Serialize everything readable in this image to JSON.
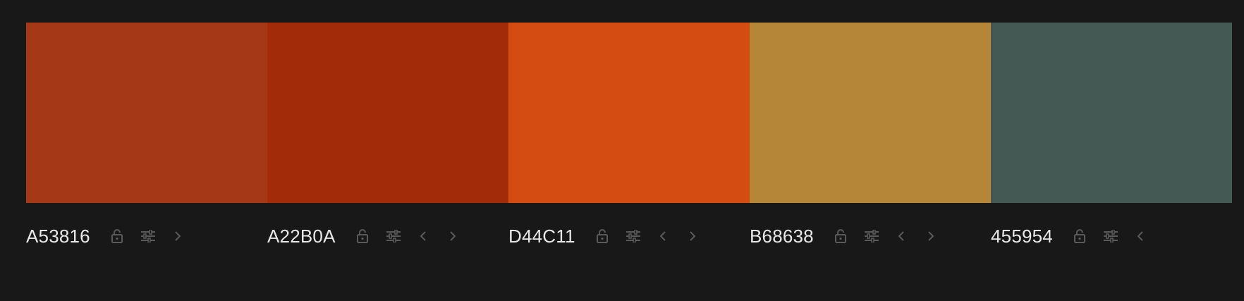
{
  "colors": [
    {
      "hex": "A53816",
      "swatch": "#A53816",
      "has_prev": false,
      "has_next": true
    },
    {
      "hex": "A22B0A",
      "swatch": "#A22B0A",
      "has_prev": true,
      "has_next": true
    },
    {
      "hex": "D44C11",
      "swatch": "#D44C11",
      "has_prev": true,
      "has_next": true
    },
    {
      "hex": "B68638",
      "swatch": "#B68638",
      "has_prev": true,
      "has_next": true
    },
    {
      "hex": "455954",
      "swatch": "#455954",
      "has_prev": true,
      "has_next": false
    }
  ],
  "ui": {
    "background": "#181818",
    "icon_color": "#5a5a5a",
    "text_color": "#e8e8e8",
    "icons": [
      "lock-icon",
      "sliders-icon",
      "chevron-left-icon",
      "chevron-right-icon"
    ]
  }
}
